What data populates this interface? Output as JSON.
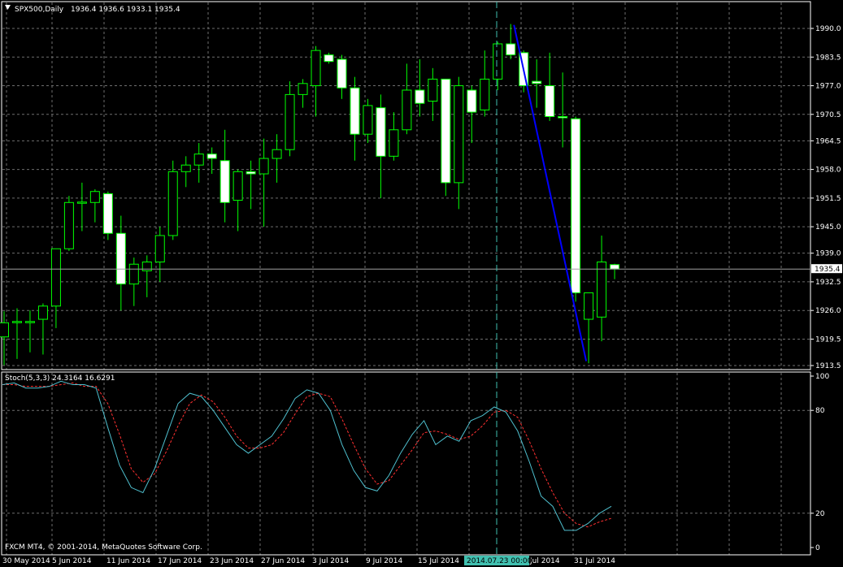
{
  "header": {
    "symbol": "SPX500,Daily",
    "ohlc": "1936.4 1936.6 1933.1 1935.4"
  },
  "indicator": {
    "label": "Stoch(5,3,3) 24.3164 16.6291"
  },
  "price_tag": "1935.4",
  "copyright": "FXCM MT4, © 2001-2014, MetaQuotes Software Corp.",
  "crosshair_label": "2014.07.23 00:00",
  "colors": {
    "background": "#000000",
    "grid": "#6e6e6e",
    "bull_body": "#000000",
    "bear_body": "#ffffff",
    "wick": "#00ff00",
    "trendline": "#0000ff",
    "stoch_main": "#4fc0cf",
    "stoch_signal": "#ff3030",
    "crosshair": "#40c0b0"
  },
  "chart_data": {
    "type": "candlestick",
    "price_ticks": [
      "1990.0",
      "1983.5",
      "1977.0",
      "1970.5",
      "1964.5",
      "1958.0",
      "1951.5",
      "1945.0",
      "1939.0",
      "1932.5",
      "1926.0",
      "1919.5",
      "1913.5"
    ],
    "date_labels": [
      "30 May 2014",
      "5 Jun 2014",
      "11 Jun 2014",
      "17 Jun 2014",
      "23 Jun 2014",
      "27 Jun 2014",
      "3 Jul 2014",
      "9 Jul 2014",
      "15 Jul 2014",
      "",
      "Jul 2014",
      "31 Jul 2014"
    ],
    "stoch_ticks": [
      "100",
      "80",
      "20",
      "0"
    ],
    "current_price": 1935.4,
    "candles": [
      {
        "o": 1920.0,
        "h": 1925.8,
        "l": 1913.6,
        "c": 1923.2
      },
      {
        "o": 1923.3,
        "h": 1926.5,
        "l": 1915.0,
        "c": 1923.5
      },
      {
        "o": 1923.5,
        "h": 1926.0,
        "l": 1916.5,
        "c": 1923.5
      },
      {
        "o": 1924.0,
        "h": 1927.6,
        "l": 1916.0,
        "c": 1927.0
      },
      {
        "o": 1927.0,
        "h": 1940.0,
        "l": 1922.0,
        "c": 1940.0
      },
      {
        "o": 1940.0,
        "h": 1952.0,
        "l": 1939.5,
        "c": 1950.5
      },
      {
        "o": 1950.5,
        "h": 1955.0,
        "l": 1944.0,
        "c": 1950.6
      },
      {
        "o": 1950.5,
        "h": 1953.5,
        "l": 1946.0,
        "c": 1953.0
      },
      {
        "o": 1952.5,
        "h": 1953.0,
        "l": 1942.0,
        "c": 1943.5
      },
      {
        "o": 1943.5,
        "h": 1947.5,
        "l": 1926.0,
        "c": 1932.0
      },
      {
        "o": 1932.0,
        "h": 1938.0,
        "l": 1927.0,
        "c": 1936.5
      },
      {
        "o": 1935.0,
        "h": 1938.5,
        "l": 1929.0,
        "c": 1937.0
      },
      {
        "o": 1937.0,
        "h": 1945.0,
        "l": 1932.5,
        "c": 1943.0
      },
      {
        "o": 1943.0,
        "h": 1960.0,
        "l": 1942.0,
        "c": 1957.5
      },
      {
        "o": 1957.5,
        "h": 1961.0,
        "l": 1954.0,
        "c": 1959.0
      },
      {
        "o": 1959.0,
        "h": 1964.0,
        "l": 1955.0,
        "c": 1961.5
      },
      {
        "o": 1961.5,
        "h": 1963.0,
        "l": 1957.0,
        "c": 1960.5
      },
      {
        "o": 1960.0,
        "h": 1967.0,
        "l": 1946.0,
        "c": 1950.5
      },
      {
        "o": 1951.0,
        "h": 1958.0,
        "l": 1944.0,
        "c": 1957.5
      },
      {
        "o": 1957.5,
        "h": 1960.0,
        "l": 1949.0,
        "c": 1957.0
      },
      {
        "o": 1957.0,
        "h": 1965.0,
        "l": 1945.0,
        "c": 1960.5
      },
      {
        "o": 1960.5,
        "h": 1966.0,
        "l": 1955.0,
        "c": 1962.5
      },
      {
        "o": 1962.5,
        "h": 1978.0,
        "l": 1961.0,
        "c": 1975.0
      },
      {
        "o": 1975.0,
        "h": 1978.5,
        "l": 1972.0,
        "c": 1977.5
      },
      {
        "o": 1977.0,
        "h": 1986.0,
        "l": 1970.0,
        "c": 1985.0
      },
      {
        "o": 1984.0,
        "h": 1984.5,
        "l": 1982.0,
        "c": 1982.5
      },
      {
        "o": 1983.0,
        "h": 1984.0,
        "l": 1974.0,
        "c": 1976.5
      },
      {
        "o": 1976.5,
        "h": 1979.0,
        "l": 1960.0,
        "c": 1966.0
      },
      {
        "o": 1966.0,
        "h": 1974.0,
        "l": 1964.0,
        "c": 1972.5
      },
      {
        "o": 1972.0,
        "h": 1975.0,
        "l": 1951.5,
        "c": 1961.0
      },
      {
        "o": 1961.0,
        "h": 1971.0,
        "l": 1960.0,
        "c": 1967.0
      },
      {
        "o": 1967.0,
        "h": 1982.0,
        "l": 1966.0,
        "c": 1976.0
      },
      {
        "o": 1976.0,
        "h": 1983.0,
        "l": 1970.0,
        "c": 1973.0
      },
      {
        "o": 1973.5,
        "h": 1981.0,
        "l": 1969.0,
        "c": 1978.5
      },
      {
        "o": 1978.5,
        "h": 1978.0,
        "l": 1952.0,
        "c": 1955.0
      },
      {
        "o": 1955.0,
        "h": 1979.0,
        "l": 1949.0,
        "c": 1977.0
      },
      {
        "o": 1976.0,
        "h": 1977.0,
        "l": 1964.0,
        "c": 1971.0
      },
      {
        "o": 1971.5,
        "h": 1985.0,
        "l": 1970.0,
        "c": 1978.5
      },
      {
        "o": 1978.5,
        "h": 1987.0,
        "l": 1976.0,
        "c": 1986.5
      },
      {
        "o": 1986.5,
        "h": 1991.0,
        "l": 1983.0,
        "c": 1984.0
      },
      {
        "o": 1984.5,
        "h": 1985.0,
        "l": 1975.5,
        "c": 1977.0
      },
      {
        "o": 1978.0,
        "h": 1983.0,
        "l": 1972.0,
        "c": 1977.5
      },
      {
        "o": 1977.0,
        "h": 1984.5,
        "l": 1969.0,
        "c": 1970.0
      },
      {
        "o": 1970.0,
        "h": 1980.0,
        "l": 1963.0,
        "c": 1969.8
      },
      {
        "o": 1969.5,
        "h": 1970.0,
        "l": 1928.0,
        "c": 1930.0
      },
      {
        "o": 1924.0,
        "h": 1930.0,
        "l": 1914.0,
        "c": 1930.0
      },
      {
        "o": 1924.5,
        "h": 1943.0,
        "l": 1919.0,
        "c": 1937.0
      },
      {
        "o": 1936.4,
        "h": 1936.6,
        "l": 1933.1,
        "c": 1935.4
      }
    ],
    "stoch_main": [
      95,
      96,
      93,
      93,
      94,
      97,
      95,
      95,
      93,
      70,
      48,
      35,
      32,
      46,
      65,
      84,
      90,
      88,
      80,
      70,
      60,
      55,
      60,
      65,
      75,
      87,
      92,
      90,
      80,
      60,
      45,
      35,
      33,
      42,
      55,
      66,
      74,
      60,
      65,
      62,
      74,
      77,
      82,
      79,
      68,
      50,
      30,
      24,
      10,
      10,
      14,
      20,
      24
    ],
    "stoch_signal": [
      95,
      95,
      94,
      94,
      94,
      95,
      96,
      94,
      94,
      84,
      66,
      46,
      38,
      43,
      56,
      71,
      84,
      89,
      85,
      76,
      65,
      58,
      58,
      60,
      67,
      78,
      88,
      90,
      88,
      75,
      60,
      46,
      37,
      39,
      48,
      57,
      67,
      68,
      66,
      63,
      65,
      71,
      79,
      80,
      76,
      62,
      46,
      32,
      20,
      14,
      12,
      15,
      17
    ]
  }
}
